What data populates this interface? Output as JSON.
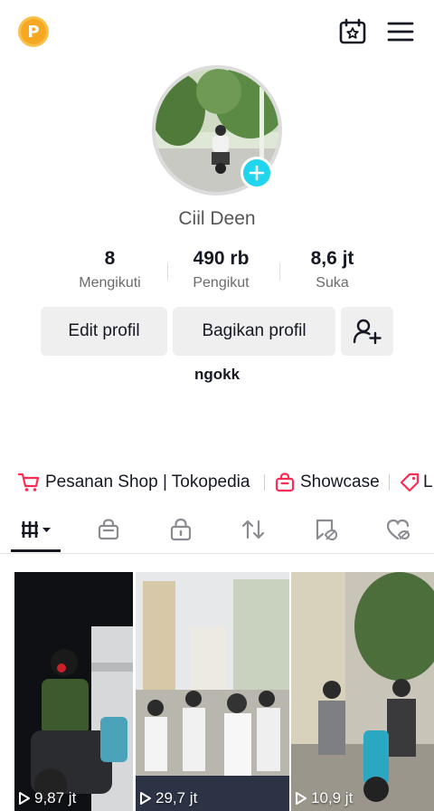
{
  "topbar": {
    "coin_letter": "P",
    "icons": [
      "calendar-star-icon",
      "hamburger-menu-icon"
    ]
  },
  "profile": {
    "name": "Ciil Deen",
    "bio": "ngokk"
  },
  "stats": [
    {
      "value": "8",
      "label": "Mengikuti"
    },
    {
      "value": "490 rb",
      "label": "Pengikut"
    },
    {
      "value": "8,6 jt",
      "label": "Suka"
    }
  ],
  "actions": {
    "edit_label": "Edit profil",
    "share_label": "Bagikan profil"
  },
  "shop": {
    "items": [
      {
        "label": "Pesanan Shop | Tokopedia"
      },
      {
        "label": "Showcase"
      },
      {
        "label": "L"
      }
    ]
  },
  "tabs": [
    {
      "icon": "videos-grid-icon",
      "active": true
    },
    {
      "icon": "shop-bag-icon"
    },
    {
      "icon": "private-lock-icon"
    },
    {
      "icon": "repost-icon"
    },
    {
      "icon": "favorites-icon"
    },
    {
      "icon": "liked-icon"
    }
  ],
  "videos": [
    {
      "views": "9,87 jt"
    },
    {
      "views": "29,7 jt"
    },
    {
      "views": "10,9 jt"
    }
  ],
  "colors": {
    "accent": "#20d5ec",
    "shop_red": "#fe2c55",
    "coin": "#f7a823"
  }
}
